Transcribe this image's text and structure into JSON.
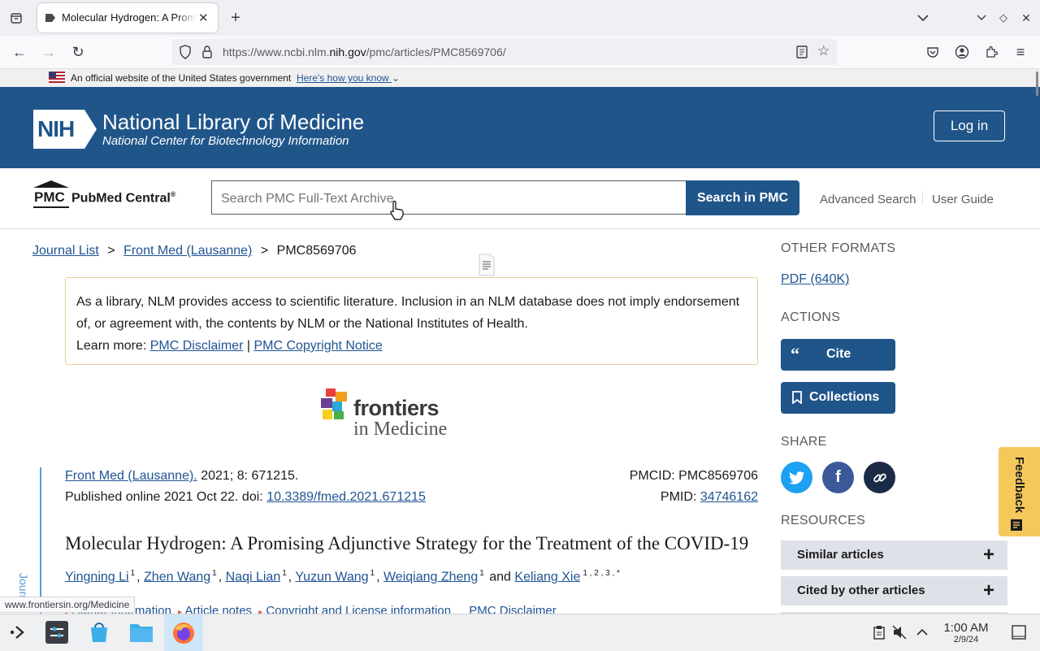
{
  "browser": {
    "tab_title": "Molecular Hydrogen: A Promising Adjunctive Strategy",
    "url_prefix": "https://www.ncbi.nlm.",
    "url_domain": "nih.gov",
    "url_path": "/pmc/articles/PMC8569706/",
    "status_url": "www.frontiersin.org/Medicine"
  },
  "gov_banner": {
    "text": "An official website of the United States government",
    "link": "Here's how you know"
  },
  "nlm": {
    "logo_text": "NIH",
    "title": "National Library of Medicine",
    "subtitle": "National Center for Biotechnology Information",
    "login": "Log in"
  },
  "pmc": {
    "logo_abbr": "PMC",
    "logo_name": "PubMed Central",
    "logo_reg": "®",
    "search_placeholder": "Search PMC Full-Text Archive",
    "search_button": "Search in PMC",
    "advanced_search": "Advanced Search",
    "user_guide": "User Guide"
  },
  "breadcrumb": {
    "journal_list": "Journal List",
    "sep1": ">",
    "journal": "Front Med (Lausanne)",
    "sep2": ">",
    "current": "PMC8569706"
  },
  "disclaimer": {
    "line1": "As a library, NLM provides access to scientific literature. Inclusion in an NLM database does not imply endorsement",
    "line2": "of, or agreement with, the contents by NLM or the National Institutes of Health.",
    "learn_more": "Learn more:",
    "link1": "PMC Disclaimer",
    "divider": "|",
    "link2": "PMC Copyright Notice"
  },
  "journal_logo": {
    "word1": "frontiers",
    "word2": "in Medicine"
  },
  "citation": {
    "journal_link": "Front Med (Lausanne).",
    "details": "2021; 8: 671215.",
    "published": "Published online 2021 Oct 22. doi:",
    "doi": "10.3389/fmed.2021.671215",
    "pmcid_label": "PMCID: PMC8569706",
    "pmid_label": "PMID:",
    "pmid": "34746162",
    "side_label": "Journal"
  },
  "article": {
    "title": "Molecular Hydrogen: A Promising Adjunctive Strategy for the Treatment of the COVID-19",
    "authors": [
      {
        "name": "Yingning Li",
        "sup": "1"
      },
      {
        "name": "Zhen Wang",
        "sup": "1"
      },
      {
        "name": "Naqi Lian",
        "sup": "1"
      },
      {
        "name": "Yuzun Wang",
        "sup": "1"
      },
      {
        "name": "Weiqiang Zheng",
        "sup": "1"
      }
    ],
    "and": "and",
    "last_author": "Keliang Xie",
    "last_sup": "1 , 2 , 3 , *",
    "links": {
      "author_info": "Author information",
      "article_notes": "Article notes",
      "copyright": "Copyright and License information",
      "pmc_disclaimer": "PMC Disclaimer"
    }
  },
  "sidebar": {
    "other_formats": "OTHER FORMATS",
    "pdf": "PDF (640K)",
    "actions": "ACTIONS",
    "cite": "Cite",
    "collections": "Collections",
    "share": "SHARE",
    "resources": "RESOURCES",
    "similar": "Similar articles",
    "cited_by": "Cited by other articles",
    "feedback": "Feedback"
  },
  "taskbar": {
    "time": "1:00 AM",
    "date": "2/9/24"
  },
  "colors": {
    "nlm_blue": "#20558a",
    "link": "#205493",
    "twitter": "#1da1f2",
    "facebook": "#3b5998",
    "permalink": "#1b2b45",
    "feedback": "#f5c85b"
  }
}
